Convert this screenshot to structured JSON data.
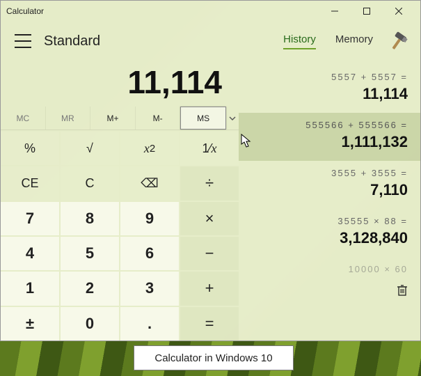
{
  "window": {
    "title": "Calculator"
  },
  "mode": "Standard",
  "tabs": {
    "history": "History",
    "memory": "Memory",
    "active": "history"
  },
  "display": "11,114",
  "memory_buttons": {
    "mc": "MC",
    "mr": "MR",
    "mplus": "M+",
    "mminus": "M-",
    "ms": "MS"
  },
  "keys": {
    "percent": "%",
    "sqrt": "√",
    "sq_prefix": "x",
    "sq_sup": "2",
    "recip_num": "1",
    "recip_sep": "⁄",
    "recip_den": "x",
    "ce": "CE",
    "c": "C",
    "back": "⌫",
    "div": "÷",
    "k7": "7",
    "k8": "8",
    "k9": "9",
    "mul": "×",
    "k4": "4",
    "k5": "5",
    "k6": "6",
    "sub": "−",
    "k1": "1",
    "k2": "2",
    "k3": "3",
    "add": "+",
    "neg": "±",
    "k0": "0",
    "dot": ".",
    "eq": "="
  },
  "history": [
    {
      "expr": "5557   +   5557 =",
      "result": "11,114"
    },
    {
      "expr": "555566   +   555566 =",
      "result": "1,111,132"
    },
    {
      "expr": "3555   +   3555 =",
      "result": "7,110"
    },
    {
      "expr": "35555   ×   88 =",
      "result": "3,128,840"
    },
    {
      "expr": "10000   ×   60",
      "result": ""
    }
  ],
  "caption": "Calculator in Windows 10"
}
